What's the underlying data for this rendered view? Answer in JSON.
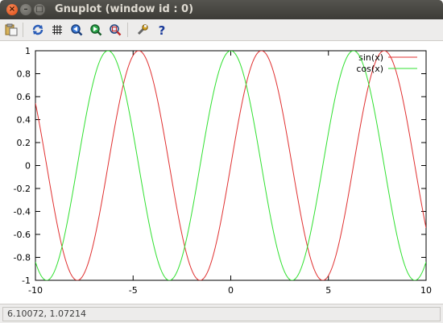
{
  "window": {
    "title": "Gnuplot (window id : 0)",
    "close_glyph": "×",
    "minimize_glyph": "–",
    "maximize_glyph": "□"
  },
  "toolbar": {
    "tools": [
      {
        "name": "copy-to-clipboard-icon"
      },
      {
        "name": "replot-icon"
      },
      {
        "name": "toggle-grid-icon"
      },
      {
        "name": "zoom-previous-icon"
      },
      {
        "name": "zoom-next-icon"
      },
      {
        "name": "autoscale-icon"
      },
      {
        "name": "configure-icon"
      },
      {
        "name": "help-icon",
        "glyph": "?"
      }
    ]
  },
  "chart_data": {
    "type": "line",
    "title": "",
    "xlabel": "",
    "ylabel": "",
    "xlim": [
      -10,
      10
    ],
    "ylim": [
      -1,
      1
    ],
    "x_ticks": [
      "-10",
      "-5",
      "0",
      "5",
      "10"
    ],
    "y_ticks": [
      "-1",
      "-0.8",
      "-0.6",
      "-0.4",
      "-0.2",
      "0",
      "0.2",
      "0.4",
      "0.6",
      "0.8",
      "1"
    ],
    "grid": false,
    "legend_position": "top-right",
    "series": [
      {
        "name": "sin(x)",
        "function": "sin",
        "color": "#e03030"
      },
      {
        "name": "cos(x)",
        "function": "cos",
        "color": "#30e030"
      }
    ]
  },
  "status": {
    "coordinates": "6.10072,  1.07214"
  }
}
